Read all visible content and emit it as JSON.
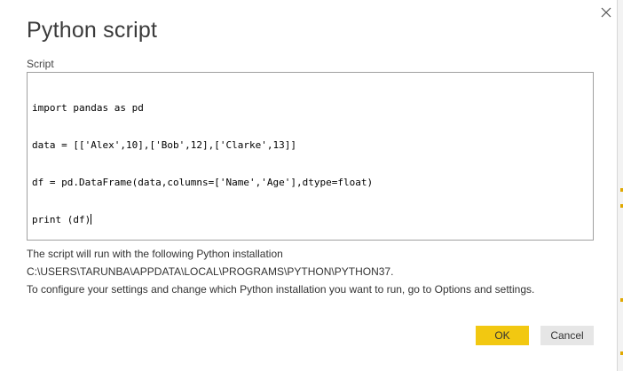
{
  "dialog": {
    "title": "Python script",
    "close_icon": "close-icon"
  },
  "script": {
    "label": "Script",
    "lines": [
      "import pandas as pd",
      "data = [['Alex',10],['Bob',12],['Clarke',13]]",
      "df = pd.DataFrame(data,columns=['Name','Age'],dtype=float)",
      "print (df)"
    ]
  },
  "info": {
    "line1": "The script will run with the following Python installation",
    "line2": "C:\\USERS\\TARUNBA\\APPDATA\\LOCAL\\PROGRAMS\\PYTHON\\PYTHON37.",
    "line3": "To configure your settings and change which Python installation you want to run, go to Options and settings."
  },
  "buttons": {
    "ok_label": "OK",
    "cancel_label": "Cancel"
  },
  "colors": {
    "ok_button": "#f2c811",
    "cancel_button": "#e6e6e6"
  }
}
